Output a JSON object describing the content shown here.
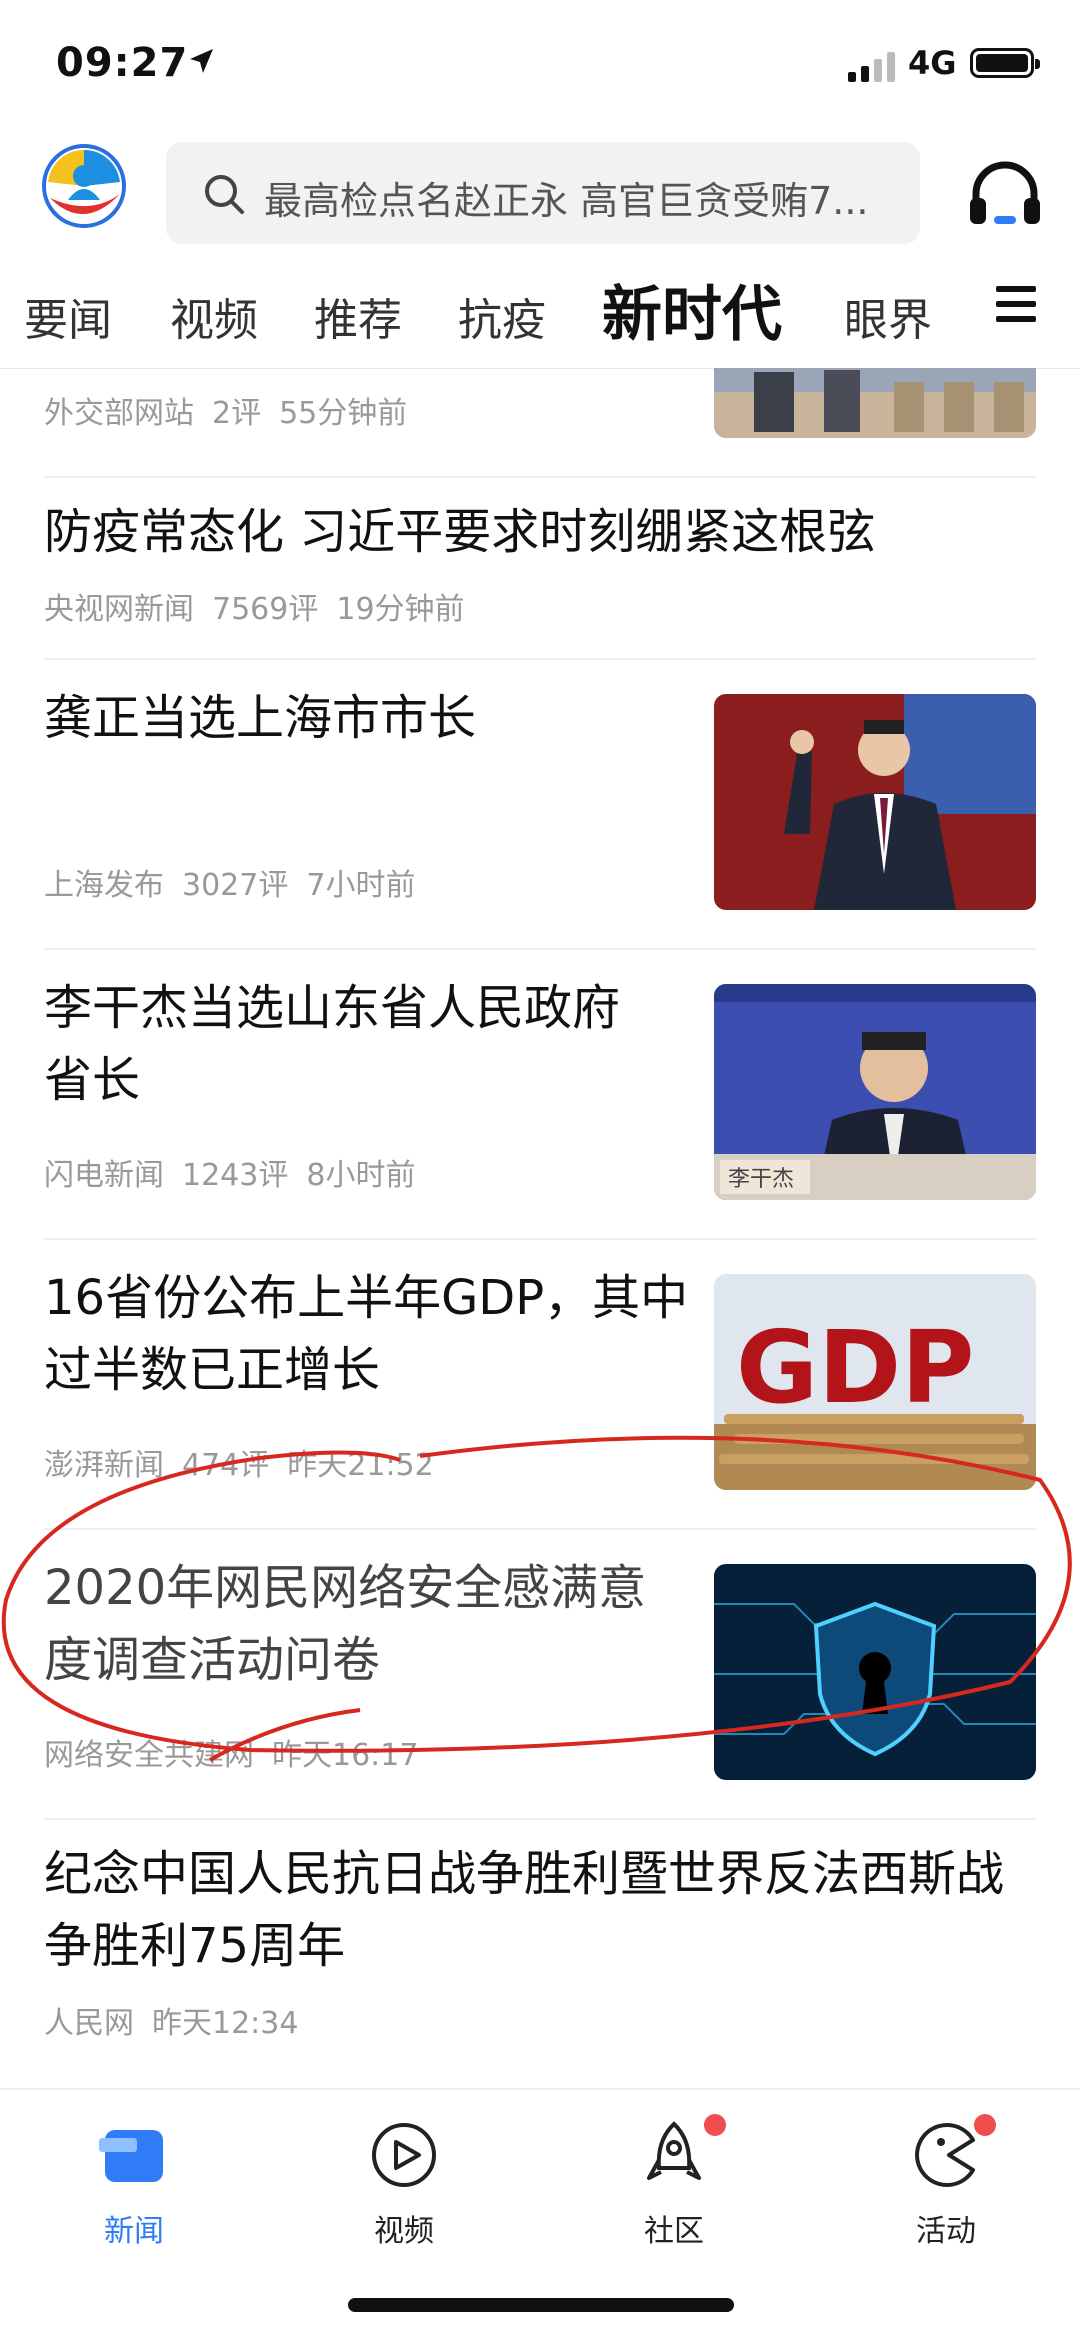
{
  "status": {
    "time": "09:27",
    "network": "4G"
  },
  "search": {
    "placeholder": "最高检点名赵正永 高官巨贪受贿7..."
  },
  "tabs": [
    {
      "label": "要闻"
    },
    {
      "label": "视频"
    },
    {
      "label": "推荐"
    },
    {
      "label": "抗疫"
    },
    {
      "label": "新时代"
    },
    {
      "label": "眼界"
    }
  ],
  "feed": [
    {
      "source": "外交部网站",
      "comments": "2评",
      "time": "55分钟前",
      "thumb": "meeting-photo"
    },
    {
      "title": "防疫常态化 习近平要求时刻绷紧这根弦",
      "source": "央视网新闻",
      "comments": "7569评",
      "time": "19分钟前"
    },
    {
      "title": "龚正当选上海市市长",
      "source": "上海发布",
      "comments": "3027评",
      "time": "7小时前",
      "thumb": "official-portrait"
    },
    {
      "title": "李干杰当选山东省人民政府省长",
      "source": "闪电新闻",
      "comments": "1243评",
      "time": "8小时前",
      "thumb": "press-conference-photo",
      "thumb_caption": "李干杰"
    },
    {
      "title": "16省份公布上半年GDP，其中过半数已正增长",
      "source": "澎湃新闻",
      "comments": "474评",
      "time": "昨天21:52",
      "thumb": "gdp-graphic",
      "thumb_caption": "GDP"
    },
    {
      "title": "2020年网民网络安全感满意度调查活动问卷",
      "source": "网络安全共建网",
      "time": "昨天16:17",
      "thumb": "cyber-security-lock"
    },
    {
      "title": "纪念中国人民抗日战争胜利暨世界反法西斯战争胜利75周年",
      "source": "人民网",
      "time": "昨天12:34"
    }
  ],
  "tabbar": [
    {
      "label": "新闻",
      "icon": "news-icon",
      "active": true
    },
    {
      "label": "视频",
      "icon": "play-icon"
    },
    {
      "label": "社区",
      "icon": "rocket-icon",
      "badge": true
    },
    {
      "label": "活动",
      "icon": "pacman-icon",
      "badge": true
    }
  ],
  "colors": {
    "accent": "#2f7cf6",
    "badge": "#f04e4e",
    "annotation": "#d6281f"
  }
}
